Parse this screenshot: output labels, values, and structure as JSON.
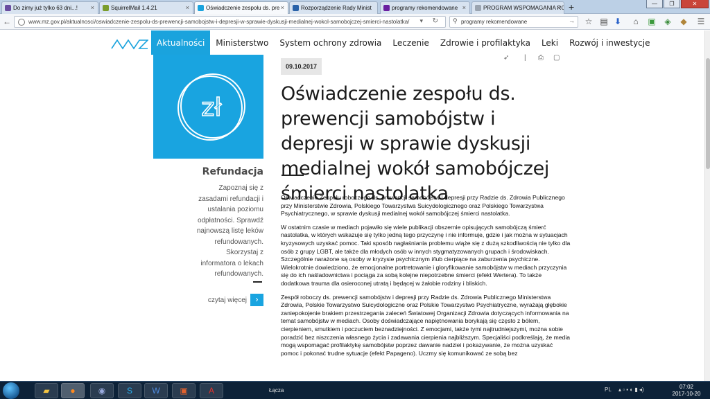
{
  "browser": {
    "tabs": [
      {
        "label": "Do zimy już tylko 63 dni...!",
        "icon": "mail-icon",
        "color": "#6a4da0"
      },
      {
        "label": "SquirrelMail 1.4.21",
        "icon": "squirrel-icon",
        "color": "#7a9c2a"
      },
      {
        "label": "Oświadczenie zespołu ds. pre",
        "icon": "mz-icon",
        "color": "#1aa3dd"
      },
      {
        "label": "Rozporządzenie Rady Minist",
        "icon": "doc-icon",
        "color": "#2a62a8"
      },
      {
        "label": "programy rekomendowane",
        "icon": "yahoo-icon",
        "color": "#6a1fa0"
      },
      {
        "label": "PROGRAM WSPOMAGANIA ROZ",
        "icon": "page-icon",
        "color": "#9aa4b0"
      }
    ],
    "url": "www.mz.gov.pl/aktualnosci/oswiadczenie-zespolu-ds-prewencji-samobojstw-i-depresji-w-sprawie-dyskusji-medialnej-wokol-samobojczej-smierci-nastolatka/",
    "search_value": "programy rekomendowane"
  },
  "site": {
    "nav": [
      "Aktualności",
      "Ministerstwo",
      "System ochrony zdrowia",
      "Leczenie",
      "Zdrowie i profilaktyka",
      "Leki",
      "Rozwój i inwestycje"
    ],
    "nav_active_color": "#1aa3dd"
  },
  "sidebar": {
    "tile_symbol": "zł",
    "title": "Refundacja",
    "text": "Zapoznaj się z zasadami refundacji i ustalania poziomu odpłatności. Sprawdź najnowszą listę leków refundowanych. Skorzystaj z informatora o lekach refundowanych.",
    "read_more": "czytaj więcej",
    "read_more_arrow": "›"
  },
  "article": {
    "date": "09.10.2017",
    "title": "Oświadczenie zespołu ds. prewencji samobójstw i depresji w sprawie dyskusji medialnej wokół samobójczej śmierci nastolatka",
    "paragraphs": [
      "Oświadczenie Zespołu roboczego ds. prewencji samobójstw i depresji przy Radzie ds.  Zdrowia Publicznego przy Ministerstwie Zdrowia, Polskiego Towarzystwa Suicydologicznego oraz Polskiego Towarzystwa Psychiatrycznego, w sprawie dyskusji medialnej wokół samobójczej śmierci nastolatka.",
      "W ostatnim czasie w mediach pojawiło się wiele publikacji obszernie opisujących samobójczą śmierć nastolatka, w których wskazuje się tylko jedną tego przyczynę i nie informuje, gdzie i jak można w sytuacjach kryzysowych uzyskać pomoc. Taki sposób nagłaśniania problemu wiąże się z dużą szkodliwością nie tylko dla osób z grupy LGBT, ale także dla młodych osób w innych stygmatyzowanych grupach i środowiskach. Szczególnie narażone są osoby w kryzysie psychicznym i/lub cierpiące na zaburzenia psychiczne. Wielokrotnie dowiedziono, że emocjonalne portretowanie i gloryfikowanie samobójstw w mediach przyczynia się do ich naśladownictwa i pociąga za sobą kolejne niepotrzebne śmierci (efekt Wertera). To także dodatkowa trauma dla osieroconej utratą i będącej w żałobie rodziny i bliskich.",
      "Zespół roboczy ds. prewencji samobójstw i depresji przy Radzie ds. Zdrowia Publicznego Ministerstwa Zdrowia, Polskie Towarzystwo Suicydologiczne oraz Polskie Towarzystwo Psychiatryczne, wyrażają głębokie zaniepokojenie brakiem przestrzegania zaleceń Światowej Organizacji Zdrowia dotyczących informowania na temat samobójstw w mediach. Osoby doświadczające napiętnowania borykają się często z bólem, cierpieniem, smutkiem i poczuciem beznadziejności. Z emocjami, także tymi najtrudniejszymi, można sobie poradzić bez niszczenia własnego życia i zadawania cierpienia najbliższym. Specjaliści podkreślają, że media mogą wspomagać profilaktykę samobójstw poprzez dawanie nadziei i pokazywanie, że można uzyskać pomoc i pokonać trudne sytuacje (efekt Papageno). Uczmy się komunikować ze sobą bez"
    ]
  },
  "taskbar": {
    "link_label": "Łącza",
    "lang": "PL",
    "time": "07:02",
    "date": "2017-10-20"
  }
}
